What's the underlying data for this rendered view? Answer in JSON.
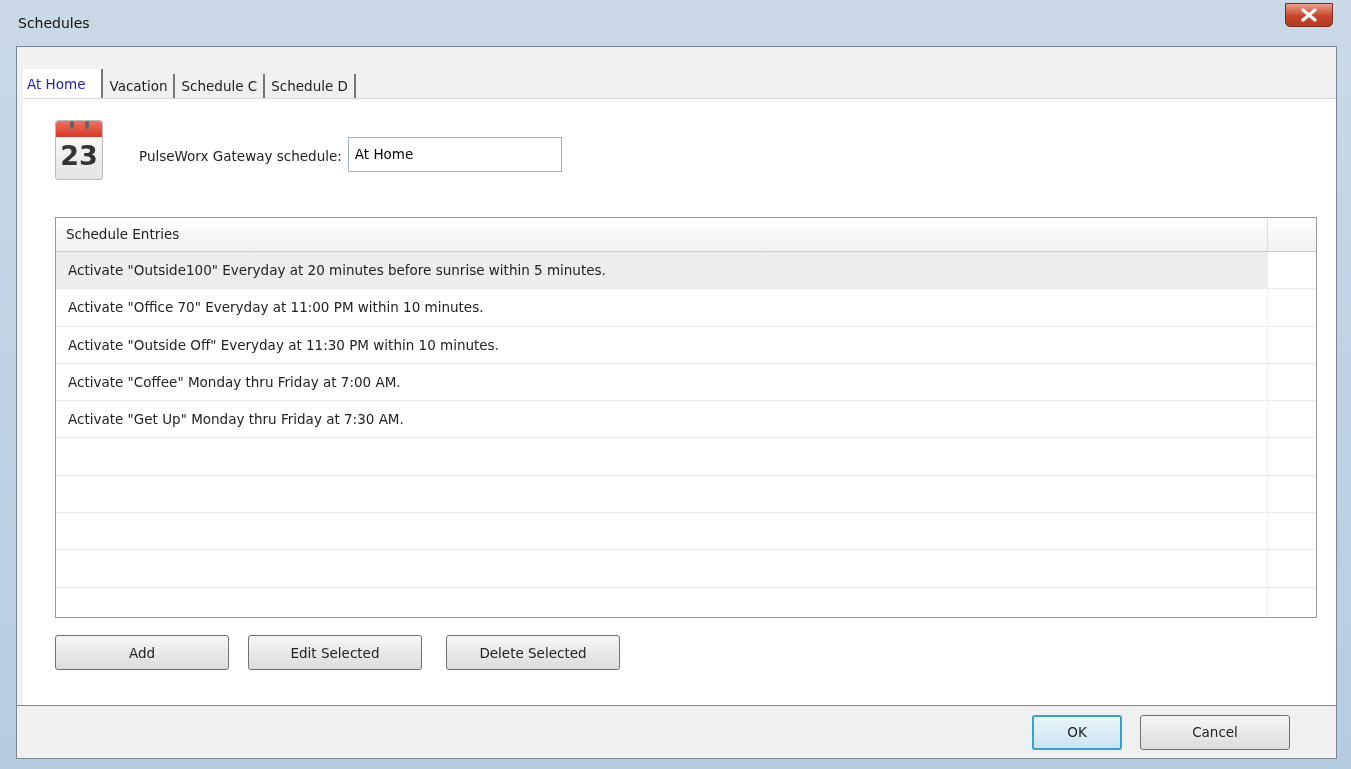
{
  "window": {
    "title": "Schedules"
  },
  "tabs": [
    {
      "label": "At Home",
      "selected": true
    },
    {
      "label": "Vacation",
      "selected": false
    },
    {
      "label": "Schedule C",
      "selected": false
    },
    {
      "label": "Schedule D",
      "selected": false
    }
  ],
  "calendar_day": "23",
  "schedule_name": {
    "label": "PulseWorx Gateway schedule:",
    "value": "At Home"
  },
  "table": {
    "columns": [
      "Schedule Entries"
    ],
    "rows": [
      {
        "text": "Activate \"Outside100\" Everyday at 20 minutes before sunrise within 5 minutes.",
        "selected": true
      },
      {
        "text": "Activate \"Office 70\" Everyday at 11:00 PM within 10 minutes.",
        "selected": false
      },
      {
        "text": "Activate \"Outside Off\" Everyday at 11:30 PM within 10 minutes.",
        "selected": false
      },
      {
        "text": "Activate \"Coffee\" Monday thru Friday at 7:00 AM.",
        "selected": false
      },
      {
        "text": "Activate \"Get Up\" Monday thru Friday at 7:30 AM.",
        "selected": false
      }
    ]
  },
  "actions": [
    "Add",
    "Edit Selected",
    "Delete Selected"
  ],
  "dialog_buttons": [
    {
      "label": "OK",
      "default": true
    },
    {
      "label": "Cancel",
      "default": false
    }
  ]
}
